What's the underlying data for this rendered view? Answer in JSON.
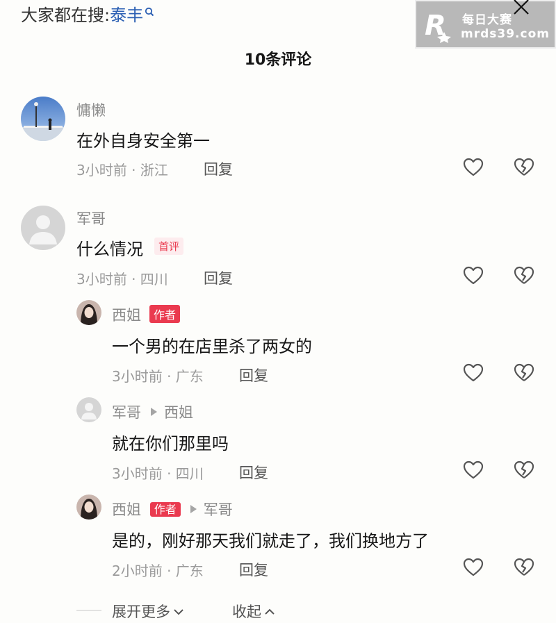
{
  "search_hint": {
    "prefix": "大家都在搜:",
    "keyword": "泰丰",
    "icon": "search-icon"
  },
  "watermark": {
    "line1": "每日大赛",
    "line2": "mrds39.com",
    "logo": "R"
  },
  "header": {
    "title": "10条评论",
    "close_icon": "close-icon"
  },
  "reply_label": "回复",
  "comments": [
    {
      "user": "慵懒",
      "text": "在外自身安全第一",
      "meta": "3小时前 · 浙江"
    },
    {
      "user": "军哥",
      "text": "什么情况",
      "badge": "首评",
      "meta": "3小时前 · 四川"
    }
  ],
  "replies": [
    {
      "user": "西姐",
      "badge": "作者",
      "text": "一个男的在店里杀了两女的",
      "meta": "3小时前 · 广东"
    },
    {
      "user": "军哥",
      "to": "西姐",
      "text": "就在你们那里吗",
      "meta": "3小时前 · 四川"
    },
    {
      "user": "西姐",
      "badge": "作者",
      "to": "军哥",
      "text": "是的，刚好那天我们就走了，我们换地方了",
      "meta": "2小时前 · 广东"
    }
  ],
  "footer": {
    "expand": "展开更多",
    "collapse": "收起"
  },
  "colors": {
    "accent_red": "#ea3a4f",
    "link_blue": "#2b5fb3"
  }
}
